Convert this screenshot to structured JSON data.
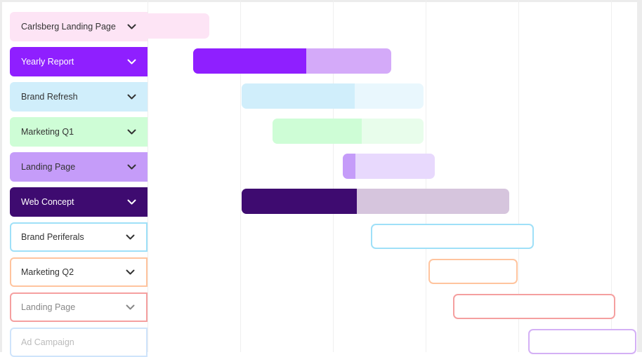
{
  "tasks": [
    {
      "name": "Carlsberg Landing Page",
      "style": "filled",
      "label_bg": "#fde4f5",
      "text_color": "#333333",
      "bar_color": "#fde4f5",
      "progress_color": "#fde4f5",
      "progress": 0
    },
    {
      "name": "Yearly Report",
      "style": "filled",
      "label_bg": "#8f1fff",
      "text_color": "#ffffff",
      "bar_color": "#d4aaf9",
      "progress_color": "#8f1fff",
      "progress": 0.57
    },
    {
      "name": "Brand Refresh",
      "style": "filled",
      "label_bg": "#d0eefb",
      "text_color": "#333333",
      "bar_color": "#e9f7fd",
      "progress_color": "#d0eefb",
      "progress": 0.62
    },
    {
      "name": "Marketing Q1",
      "style": "filled",
      "label_bg": "#cefdd6",
      "text_color": "#333333",
      "bar_color": "#e8fdeb",
      "progress_color": "#cefdd6",
      "progress": 0.59
    },
    {
      "name": "Landing Page",
      "style": "filled",
      "label_bg": "#c59cf9",
      "text_color": "#333333",
      "bar_color": "#e8d9fd",
      "progress_color": "#c59cf9",
      "progress": 0.14
    },
    {
      "name": "Web Concept",
      "style": "filled",
      "label_bg": "#3e0b70",
      "text_color": "#ffffff",
      "bar_color": "#d6c5dd",
      "progress_color": "#3e0b70",
      "progress": 0.43
    },
    {
      "name": "Brand Periferals",
      "style": "outline",
      "border": "#9fe0f8",
      "text_color": "#333333",
      "progress": 0
    },
    {
      "name": "Marketing Q2",
      "style": "outline",
      "border": "#ffc49e",
      "text_color": "#333333",
      "progress": 0
    },
    {
      "name": "Landing Page",
      "style": "outline",
      "border": "#f5a0a0",
      "text_color": "#888888",
      "progress": 0
    },
    {
      "name": "Ad Campaign",
      "style": "outline",
      "border": "#cfe4fb",
      "bar_border": "#d4b0f5",
      "text_color": "#bbbbbb",
      "progress": 0
    }
  ],
  "icons": {
    "expand": "chevron-down-icon"
  }
}
